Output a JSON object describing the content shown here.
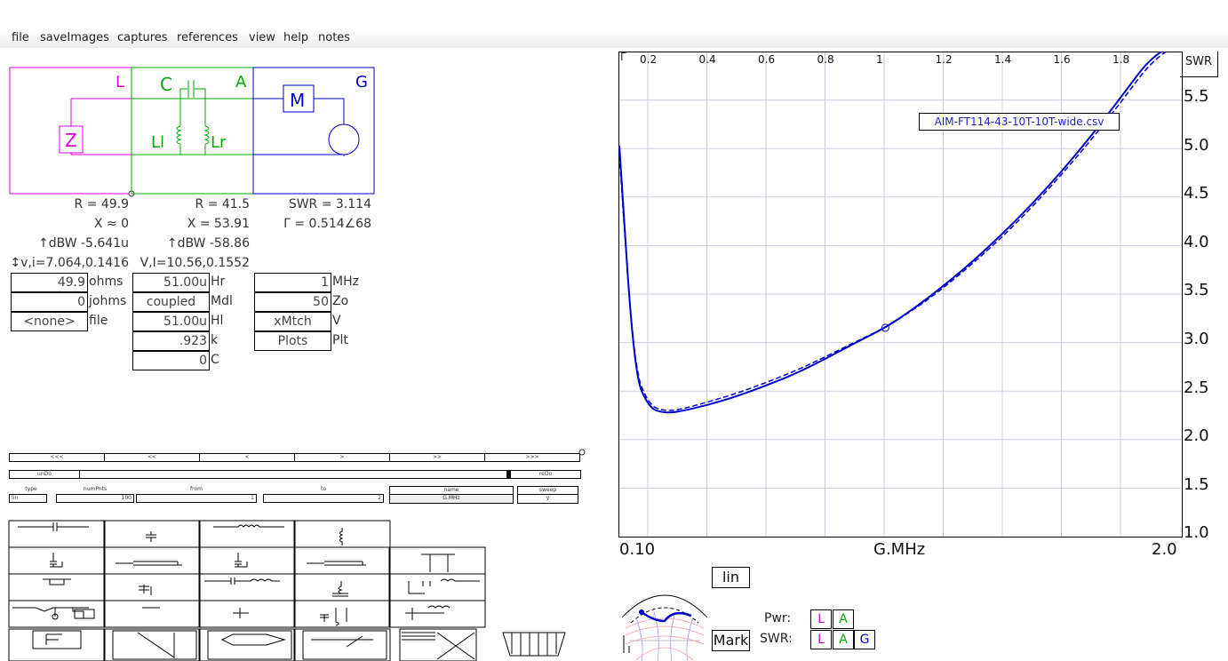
{
  "menu": [
    "file",
    "saveImages",
    "captures",
    "references",
    "view",
    "help",
    "notes"
  ],
  "circuit": {
    "L": "L",
    "C": "C",
    "A": "A",
    "G": "G",
    "Z": "Z",
    "M": "M",
    "Ll": "Ll",
    "Lr": "Lr"
  },
  "readout": {
    "col1": [
      "R = 49.9",
      "X ≈ 0",
      "↑dBW -5.641u",
      "↕v,i=7.064,0.1416"
    ],
    "col2": [
      "R = 41.5",
      "X = 53.91",
      "↑dBW -58.86",
      "V,I=10.56,0.1552"
    ],
    "col3": [
      "SWR = 3.114",
      "Γ = 0.514∠68"
    ]
  },
  "load_fields": [
    {
      "value": "49.9",
      "unit": "ohms"
    },
    {
      "value": "0",
      "unit": "johms"
    },
    {
      "value": "<none>",
      "unit": "file"
    }
  ],
  "adapter_fields": [
    {
      "value": "51.00u",
      "unit": "Hr"
    },
    {
      "value": "coupled",
      "unit": "Mdl"
    },
    {
      "value": "51.00u",
      "unit": "Hl"
    },
    {
      "value": ".923",
      "unit": "k"
    },
    {
      "value": "0",
      "unit": "C"
    }
  ],
  "gen_fields": [
    {
      "value": "1",
      "unit": "MHz"
    },
    {
      "value": "50",
      "unit": "Zo"
    },
    {
      "value": "xMtch",
      "unit": "V"
    },
    {
      "value": "Plots",
      "unit": "Plt"
    }
  ],
  "nav": [
    "<<<",
    "<<",
    "<",
    ">",
    ">>",
    ">>>"
  ],
  "undo": {
    "undo": "unDo",
    "redo": "reDo"
  },
  "sweep": {
    "type_label": "type",
    "type_value": "lin",
    "numpnts_label": "numPnts",
    "numpnts_value": "100",
    "from_label": "from",
    "from_value": "1",
    "to_label": "to",
    "to_value": "2",
    "name_label": "name",
    "name_value": "G.MHz",
    "sweep_label": "sweep",
    "sweep_value": "y"
  },
  "plot": {
    "legend": "AIM-FT114-43-10T-10T-wide.csv",
    "top_corner": "Γ",
    "top_ticks": [
      "0.2",
      "0.4",
      "0.6",
      "0.8",
      "1",
      "1.2",
      "1.4",
      "1.6",
      "1.8"
    ],
    "y_title": "SWR",
    "y_ticks": [
      "5.5",
      "5.0",
      "4.5",
      "4.0",
      "3.5",
      "3.0",
      "2.5",
      "2.0",
      "1.5",
      "1.0"
    ],
    "x_left": "0.10",
    "x_mid": "G.MHz",
    "x_right": "2.0"
  },
  "chart_data": {
    "type": "line",
    "x": [
      0.1,
      0.15,
      0.2,
      0.25,
      0.3,
      0.4,
      0.5,
      0.6,
      0.7,
      0.8,
      0.9,
      1.0,
      1.1,
      1.2,
      1.3,
      1.4,
      1.5,
      1.6,
      1.7,
      1.8,
      1.9,
      2.0
    ],
    "series": [
      {
        "values": [
          4.95,
          2.65,
          2.3,
          2.25,
          2.26,
          2.33,
          2.42,
          2.53,
          2.65,
          2.8,
          2.96,
          3.11,
          3.31,
          3.54,
          3.79,
          4.07,
          4.37,
          4.7,
          5.06,
          5.45,
          5.85,
          6.0
        ]
      },
      {
        "values": [
          4.85,
          2.7,
          2.33,
          2.27,
          2.28,
          2.36,
          2.45,
          2.56,
          2.68,
          2.82,
          2.97,
          3.11,
          3.3,
          3.52,
          3.77,
          4.04,
          4.34,
          4.67,
          5.02,
          5.4,
          5.8,
          6.0
        ]
      }
    ],
    "ylabel": "SWR",
    "xlabel": "G.MHz",
    "xlim": [
      0.1,
      2.0
    ],
    "ylim": [
      1.0,
      5.9
    ],
    "marker": {
      "x": 1.0,
      "y": 3.11
    },
    "grid": true
  },
  "buttons": {
    "lin": "lin",
    "mark": "Mark",
    "pwr": "Pwr:",
    "swr": "SWR:",
    "L": "L",
    "A": "A",
    "G": "G"
  }
}
